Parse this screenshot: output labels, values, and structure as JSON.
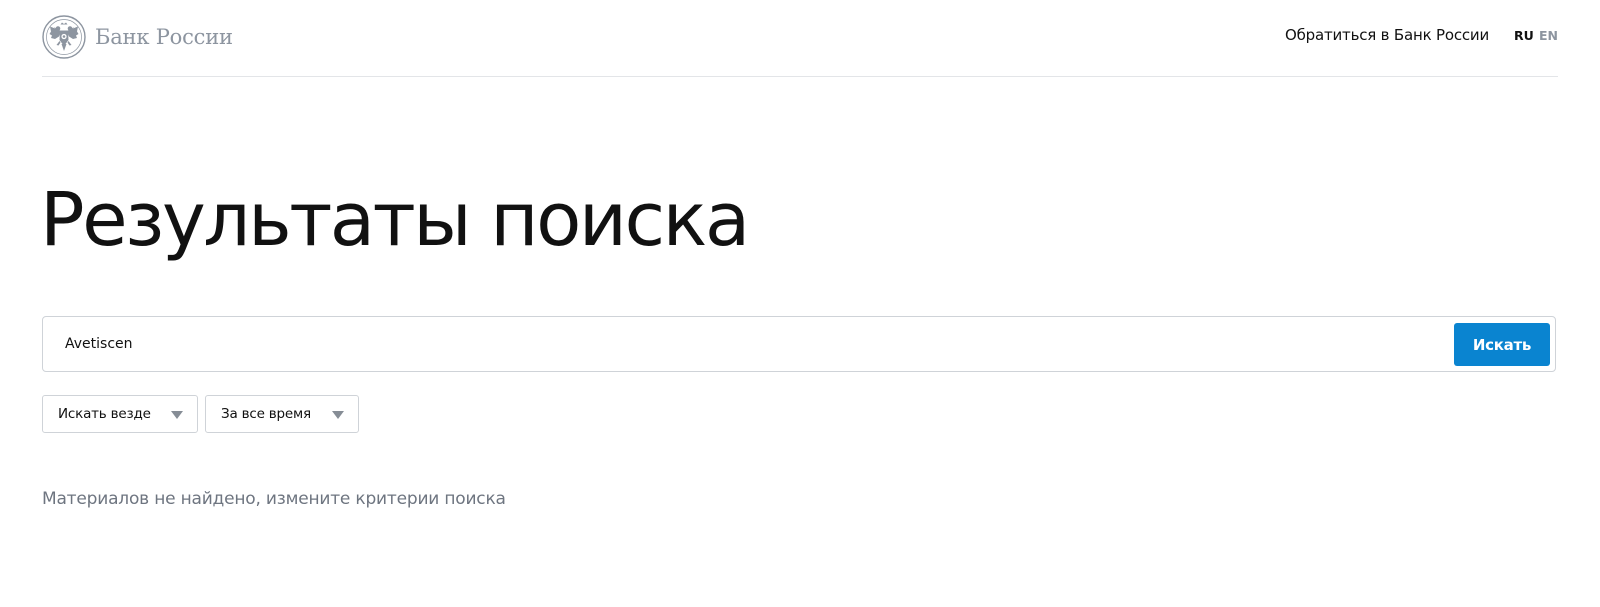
{
  "header": {
    "logo_text": "Банк России",
    "emblem_icon": "double-headed-eagle-icon",
    "contact_link": "Обратиться в Банк России",
    "languages": {
      "ru": "RU",
      "en": "EN",
      "active": "RU"
    }
  },
  "page": {
    "title": "Результаты поиска"
  },
  "search": {
    "query": "Avetiscen",
    "button_label": "Искать"
  },
  "filters": {
    "scope": {
      "selected": "Искать везде",
      "icon": "chevron-down-icon"
    },
    "period": {
      "selected": "За все время",
      "icon": "chevron-down-icon"
    }
  },
  "results": {
    "empty_message": "Материалов не найдено, измените критерии поиска"
  },
  "colors": {
    "accent": "#0a84d0",
    "text": "#111111",
    "muted": "#6e7580",
    "logo": "#8d95a0",
    "border": "#cfd3d8"
  }
}
